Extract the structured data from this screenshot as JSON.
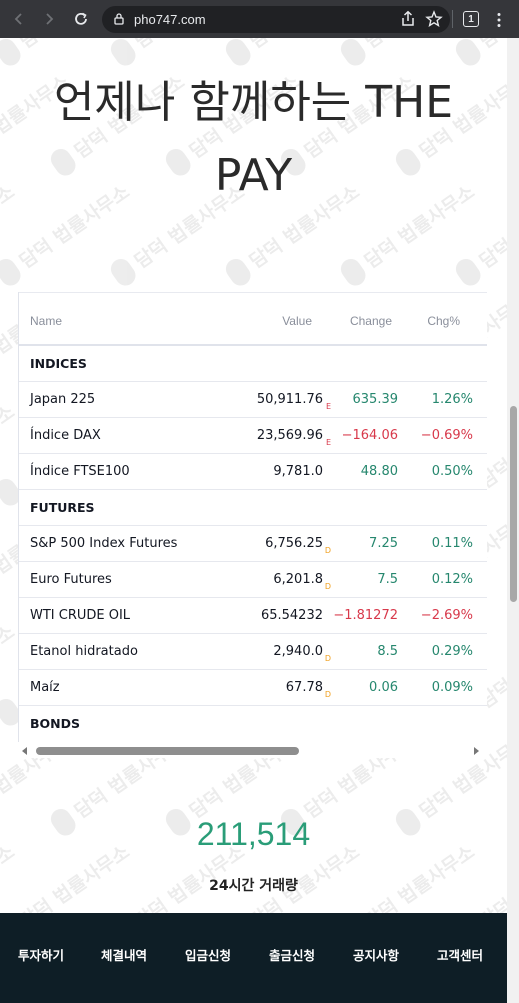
{
  "browser": {
    "url": "pho747.com",
    "tab_count": "1"
  },
  "hero": {
    "title_line1": "언제나 함께하는 THE",
    "title_line2": "PAY"
  },
  "ticker": {
    "columns": {
      "name": "Name",
      "value": "Value",
      "change": "Change",
      "chg_pct": "Chg%"
    },
    "groups": [
      {
        "label": "INDICES"
      },
      {
        "label": "FUTURES"
      },
      {
        "label": "BONDS"
      }
    ],
    "rows": [
      {
        "name": "Japan 225",
        "value": "50,911.76",
        "flag": "E",
        "change": "635.39",
        "pct": "1.26%",
        "trend": "up"
      },
      {
        "name": "Índice DAX",
        "value": "23,569.96",
        "flag": "E",
        "change": "−164.06",
        "pct": "−0.69%",
        "trend": "down"
      },
      {
        "name": "Índice FTSE100",
        "value": "9,781.0",
        "flag": "",
        "change": "48.80",
        "pct": "0.50%",
        "trend": "up"
      },
      {
        "name": "S&P 500 Index Futures",
        "value": "6,756.25",
        "flag": "D",
        "change": "7.25",
        "pct": "0.11%",
        "trend": "up"
      },
      {
        "name": "Euro Futures",
        "value": "6,201.8",
        "flag": "D",
        "change": "7.5",
        "pct": "0.12%",
        "trend": "up"
      },
      {
        "name": "WTI CRUDE OIL",
        "value": "65.54232",
        "flag": "",
        "change": "−1.81272",
        "pct": "−2.69%",
        "trend": "down"
      },
      {
        "name": "Etanol hidratado",
        "value": "2,940.0",
        "flag": "D",
        "change": "8.5",
        "pct": "0.29%",
        "trend": "up"
      },
      {
        "name": "Maíz",
        "value": "67.78",
        "flag": "D",
        "change": "0.06",
        "pct": "0.09%",
        "trend": "up"
      }
    ]
  },
  "stats": {
    "value": "211,514",
    "label": "24시간 거래량"
  },
  "footer": {
    "items": [
      "투자하기",
      "체결내역",
      "입금신청",
      "출금신청",
      "공지사항",
      "고객센터"
    ]
  },
  "watermark": {
    "text": "담덕 법률사무소"
  },
  "colors": {
    "positive": "#26876e",
    "negative": "#d8394b",
    "accent": "#2a9d78",
    "footer_bg": "#0e1e26",
    "flag_delayed": "#f0a020",
    "flag_eod": "#d8394b"
  }
}
